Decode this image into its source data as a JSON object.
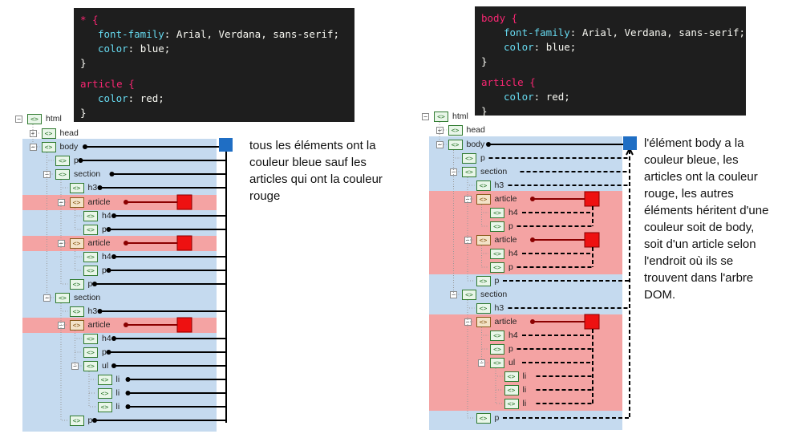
{
  "left": {
    "code_lines": [
      {
        "sel": "* {"
      },
      {
        "prop": "font-family",
        "val": " Arial, Verdana, sans-serif;"
      },
      {
        "prop": "color",
        "val": " blue;"
      },
      {
        "close": "}"
      },
      {
        "sel": "article {"
      },
      {
        "prop": "color",
        "val": " red;"
      },
      {
        "close": "}"
      }
    ],
    "note": "tous les éléments ont la couleur bleue sauf les articles qui ont la couleur rouge"
  },
  "right": {
    "code_lines": [
      {
        "sel": "body {"
      },
      {
        "prop": "font-family",
        "val": " Arial, Verdana, sans-serif;"
      },
      {
        "prop": "color",
        "val": " blue;"
      },
      {
        "close": "}"
      },
      {
        "sel": "article {"
      },
      {
        "prop": "color",
        "val": " red;"
      },
      {
        "close": "}"
      }
    ],
    "note": "l'élément body a la couleur bleue, les articles ont la couleur rouge, les autres éléments héritent d'une couleur soit de body, soit d'un article selon l'endroit où ils se trouvent dans l'arbre DOM."
  },
  "tree": [
    "html",
    "head",
    "body",
    "p",
    "section",
    "h3",
    "article",
    "h4",
    "p",
    "article",
    "h4",
    "p",
    "p",
    "section",
    "h3",
    "article",
    "h4",
    "p",
    "ul",
    "li",
    "li",
    "li",
    "p"
  ],
  "colors": {
    "blue_bg": "#c5daef",
    "red_bg": "#f4a3a3",
    "blue_marker": "#1f6ec4",
    "red_marker": "#ee1111",
    "icon": "xml-tag-icon"
  }
}
